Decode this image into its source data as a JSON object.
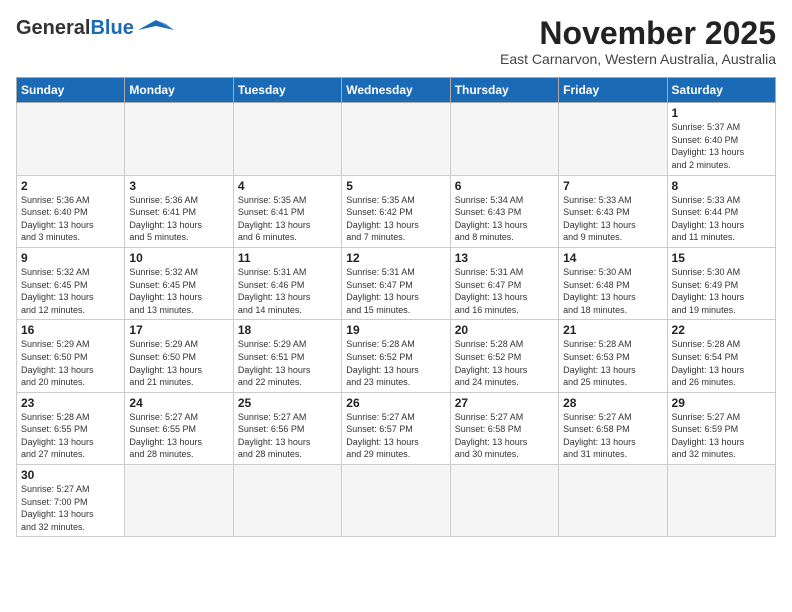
{
  "logo": {
    "line1": "General",
    "line2": "Blue"
  },
  "header": {
    "month": "November 2025",
    "location": "East Carnarvon, Western Australia, Australia"
  },
  "days_of_week": [
    "Sunday",
    "Monday",
    "Tuesday",
    "Wednesday",
    "Thursday",
    "Friday",
    "Saturday"
  ],
  "weeks": [
    [
      {
        "day": "",
        "info": ""
      },
      {
        "day": "",
        "info": ""
      },
      {
        "day": "",
        "info": ""
      },
      {
        "day": "",
        "info": ""
      },
      {
        "day": "",
        "info": ""
      },
      {
        "day": "",
        "info": ""
      },
      {
        "day": "1",
        "info": "Sunrise: 5:37 AM\nSunset: 6:40 PM\nDaylight: 13 hours\nand 2 minutes."
      }
    ],
    [
      {
        "day": "2",
        "info": "Sunrise: 5:36 AM\nSunset: 6:40 PM\nDaylight: 13 hours\nand 3 minutes."
      },
      {
        "day": "3",
        "info": "Sunrise: 5:36 AM\nSunset: 6:41 PM\nDaylight: 13 hours\nand 5 minutes."
      },
      {
        "day": "4",
        "info": "Sunrise: 5:35 AM\nSunset: 6:41 PM\nDaylight: 13 hours\nand 6 minutes."
      },
      {
        "day": "5",
        "info": "Sunrise: 5:35 AM\nSunset: 6:42 PM\nDaylight: 13 hours\nand 7 minutes."
      },
      {
        "day": "6",
        "info": "Sunrise: 5:34 AM\nSunset: 6:43 PM\nDaylight: 13 hours\nand 8 minutes."
      },
      {
        "day": "7",
        "info": "Sunrise: 5:33 AM\nSunset: 6:43 PM\nDaylight: 13 hours\nand 9 minutes."
      },
      {
        "day": "8",
        "info": "Sunrise: 5:33 AM\nSunset: 6:44 PM\nDaylight: 13 hours\nand 11 minutes."
      }
    ],
    [
      {
        "day": "9",
        "info": "Sunrise: 5:32 AM\nSunset: 6:45 PM\nDaylight: 13 hours\nand 12 minutes."
      },
      {
        "day": "10",
        "info": "Sunrise: 5:32 AM\nSunset: 6:45 PM\nDaylight: 13 hours\nand 13 minutes."
      },
      {
        "day": "11",
        "info": "Sunrise: 5:31 AM\nSunset: 6:46 PM\nDaylight: 13 hours\nand 14 minutes."
      },
      {
        "day": "12",
        "info": "Sunrise: 5:31 AM\nSunset: 6:47 PM\nDaylight: 13 hours\nand 15 minutes."
      },
      {
        "day": "13",
        "info": "Sunrise: 5:31 AM\nSunset: 6:47 PM\nDaylight: 13 hours\nand 16 minutes."
      },
      {
        "day": "14",
        "info": "Sunrise: 5:30 AM\nSunset: 6:48 PM\nDaylight: 13 hours\nand 18 minutes."
      },
      {
        "day": "15",
        "info": "Sunrise: 5:30 AM\nSunset: 6:49 PM\nDaylight: 13 hours\nand 19 minutes."
      }
    ],
    [
      {
        "day": "16",
        "info": "Sunrise: 5:29 AM\nSunset: 6:50 PM\nDaylight: 13 hours\nand 20 minutes."
      },
      {
        "day": "17",
        "info": "Sunrise: 5:29 AM\nSunset: 6:50 PM\nDaylight: 13 hours\nand 21 minutes."
      },
      {
        "day": "18",
        "info": "Sunrise: 5:29 AM\nSunset: 6:51 PM\nDaylight: 13 hours\nand 22 minutes."
      },
      {
        "day": "19",
        "info": "Sunrise: 5:28 AM\nSunset: 6:52 PM\nDaylight: 13 hours\nand 23 minutes."
      },
      {
        "day": "20",
        "info": "Sunrise: 5:28 AM\nSunset: 6:52 PM\nDaylight: 13 hours\nand 24 minutes."
      },
      {
        "day": "21",
        "info": "Sunrise: 5:28 AM\nSunset: 6:53 PM\nDaylight: 13 hours\nand 25 minutes."
      },
      {
        "day": "22",
        "info": "Sunrise: 5:28 AM\nSunset: 6:54 PM\nDaylight: 13 hours\nand 26 minutes."
      }
    ],
    [
      {
        "day": "23",
        "info": "Sunrise: 5:28 AM\nSunset: 6:55 PM\nDaylight: 13 hours\nand 27 minutes."
      },
      {
        "day": "24",
        "info": "Sunrise: 5:27 AM\nSunset: 6:55 PM\nDaylight: 13 hours\nand 28 minutes."
      },
      {
        "day": "25",
        "info": "Sunrise: 5:27 AM\nSunset: 6:56 PM\nDaylight: 13 hours\nand 28 minutes."
      },
      {
        "day": "26",
        "info": "Sunrise: 5:27 AM\nSunset: 6:57 PM\nDaylight: 13 hours\nand 29 minutes."
      },
      {
        "day": "27",
        "info": "Sunrise: 5:27 AM\nSunset: 6:58 PM\nDaylight: 13 hours\nand 30 minutes."
      },
      {
        "day": "28",
        "info": "Sunrise: 5:27 AM\nSunset: 6:58 PM\nDaylight: 13 hours\nand 31 minutes."
      },
      {
        "day": "29",
        "info": "Sunrise: 5:27 AM\nSunset: 6:59 PM\nDaylight: 13 hours\nand 32 minutes."
      }
    ],
    [
      {
        "day": "30",
        "info": "Sunrise: 5:27 AM\nSunset: 7:00 PM\nDaylight: 13 hours\nand 32 minutes."
      },
      {
        "day": "",
        "info": ""
      },
      {
        "day": "",
        "info": ""
      },
      {
        "day": "",
        "info": ""
      },
      {
        "day": "",
        "info": ""
      },
      {
        "day": "",
        "info": ""
      },
      {
        "day": "",
        "info": ""
      }
    ]
  ]
}
